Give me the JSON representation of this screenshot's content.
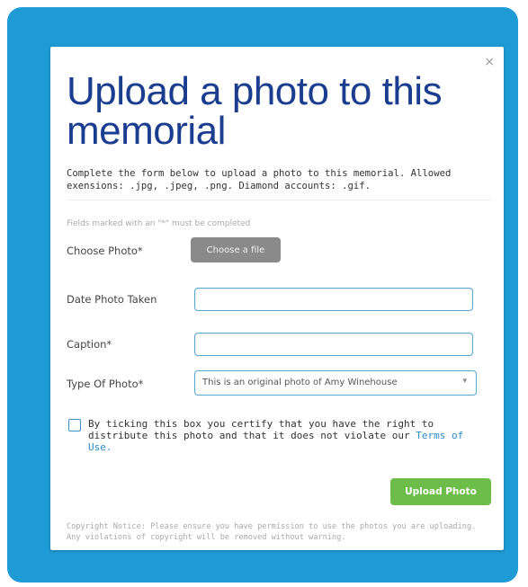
{
  "modal": {
    "close_symbol": "×",
    "title": "Upload a photo to this memorial",
    "intro": "Complete the form below to upload a photo to this memorial. Allowed exensions: .jpg, .jpeg, .png. Diamond accounts: .gif.",
    "required_note": "Fields marked with an \"*\" must be completed"
  },
  "form": {
    "choose_photo_label": "Choose Photo*",
    "choose_file_button": "Choose a file",
    "date_label": "Date Photo Taken",
    "date_value": "",
    "caption_label": "Caption*",
    "caption_value": "",
    "type_label": "Type Of Photo*",
    "type_selected": "This is an original photo of Amy Winehouse",
    "type_arrow": "▾",
    "terms_text": "By ticking this box you certify that you have the right to distribute this photo and that it does not violate our ",
    "terms_link": "Terms of Use.",
    "upload_button": "Upload Photo",
    "copyright_notice": "Copyright Notice: Please ensure you have permission to use the photos you are uploading. Any violations of copyright will be removed without warning."
  },
  "colors": {
    "frame": "#1e9bd5",
    "title": "#1b3d8f",
    "upload_button": "#6dbd4b",
    "choose_button": "#8a8a8a",
    "link": "#2a8ac8"
  },
  "icons": {
    "close": "close-icon",
    "dropdown": "chevron-down-icon",
    "checkbox": "checkbox-unchecked"
  }
}
